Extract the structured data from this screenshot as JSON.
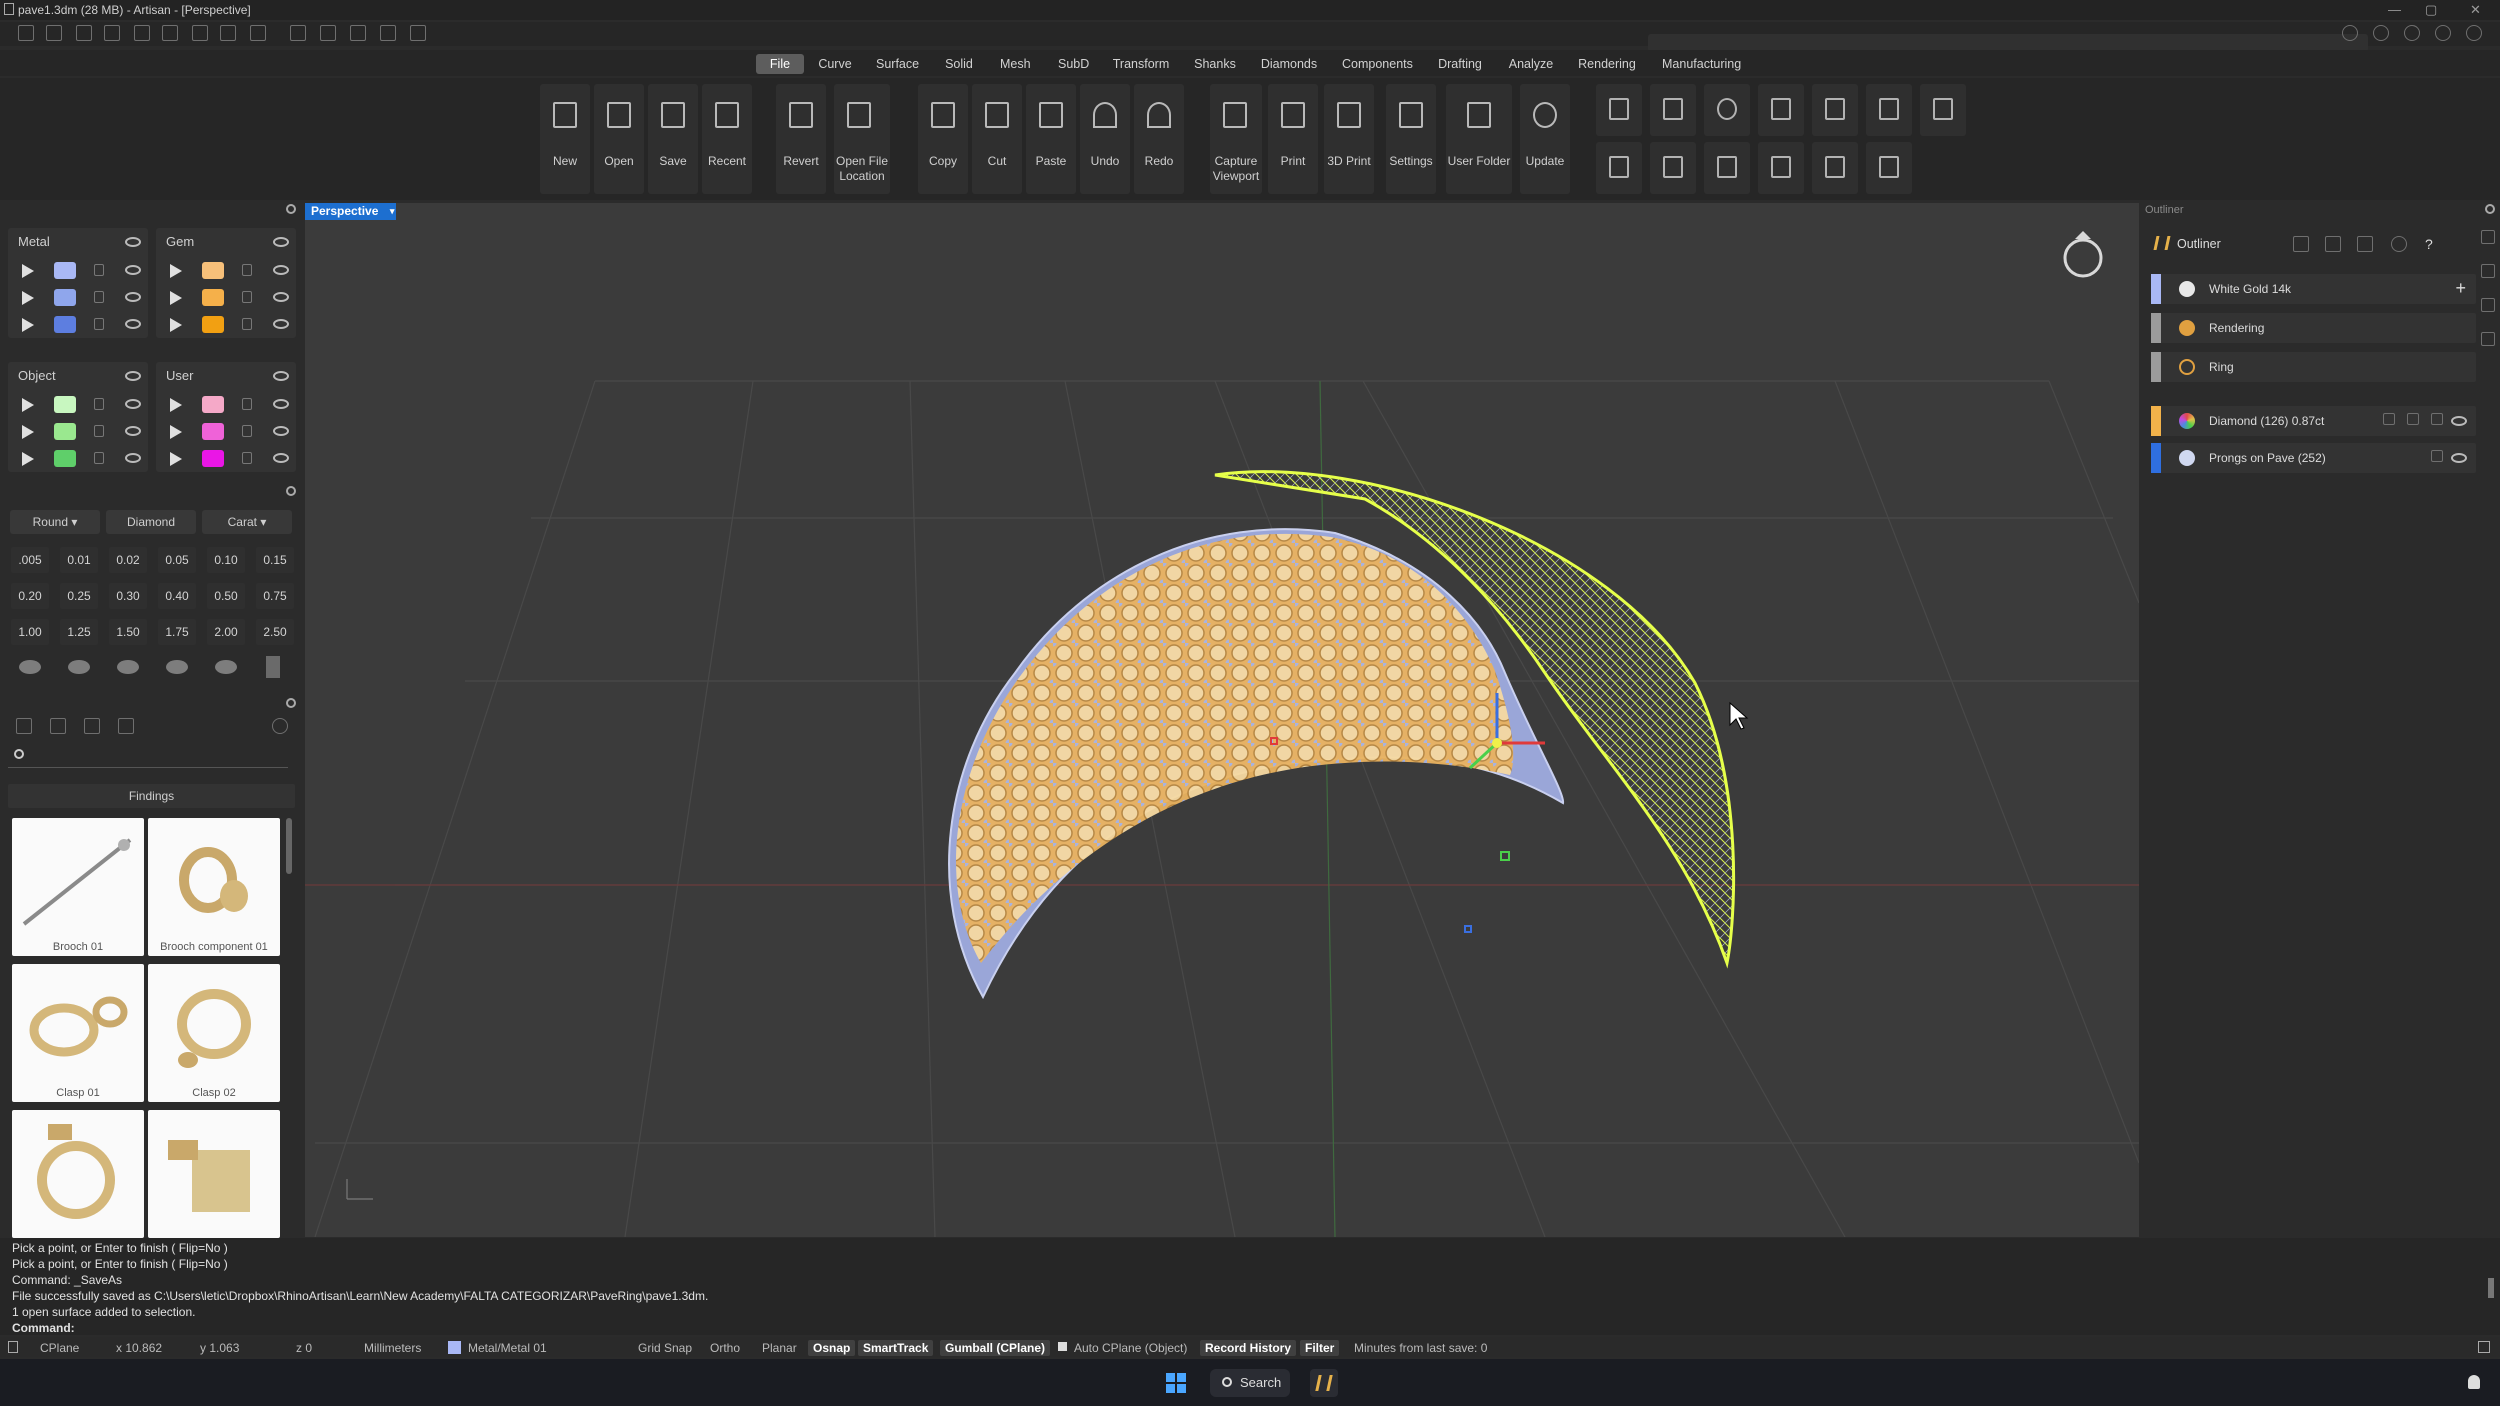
{
  "window": {
    "title": "pave1.3dm (28 MB) - Artisan - [Perspective]"
  },
  "menu": {
    "items": [
      "File",
      "Curve",
      "Surface",
      "Solid",
      "Mesh",
      "SubD",
      "Transform",
      "Shanks",
      "Diamonds",
      "Components",
      "Drafting",
      "Analyze",
      "Rendering",
      "Manufacturing"
    ],
    "active": "File"
  },
  "ribbon": {
    "buttons": [
      {
        "label": "New",
        "icon": "new-file-icon"
      },
      {
        "label": "Open",
        "icon": "folder-open-icon"
      },
      {
        "label": "Save",
        "icon": "save-icon"
      },
      {
        "label": "Recent",
        "icon": "recent-file-icon"
      },
      {
        "label": "Revert",
        "icon": "revert-icon"
      },
      {
        "label": "Open File Location",
        "icon": "folder-location-icon"
      },
      {
        "label": "Copy",
        "icon": "copy-icon"
      },
      {
        "label": "Cut",
        "icon": "scissors-icon"
      },
      {
        "label": "Paste",
        "icon": "paste-icon"
      },
      {
        "label": "Undo",
        "icon": "undo-icon"
      },
      {
        "label": "Redo",
        "icon": "redo-icon"
      },
      {
        "label": "Capture Viewport",
        "icon": "capture-icon"
      },
      {
        "label": "Print",
        "icon": "print-icon"
      },
      {
        "label": "3D Print",
        "icon": "3d-print-icon"
      },
      {
        "label": "Settings",
        "icon": "settings-icon"
      },
      {
        "label": "User Folder",
        "icon": "user-folder-icon"
      },
      {
        "label": "Update",
        "icon": "refresh-icon"
      }
    ]
  },
  "layers": {
    "metal": {
      "title": "Metal",
      "colors": [
        "#a9b8f5",
        "#8fa6ec",
        "#5d7ee0"
      ]
    },
    "gem": {
      "title": "Gem",
      "colors": [
        "#f7c07a",
        "#f5b04a",
        "#f2a012"
      ]
    },
    "object": {
      "title": "Object",
      "colors": [
        "#c8f7c0",
        "#9ae88f",
        "#5fcf6a"
      ]
    },
    "user": {
      "title": "User",
      "colors": [
        "#f5a9c8",
        "#ef62d8",
        "#ea16e6"
      ]
    }
  },
  "gem_selector": {
    "cut": "Round",
    "type": "Diamond",
    "unit": "Carat",
    "sizes": [
      ".005",
      "0.01",
      "0.02",
      "0.05",
      "0.10",
      "0.15",
      "0.20",
      "0.25",
      "0.30",
      "0.40",
      "0.50",
      "0.75",
      "1.00",
      "1.25",
      "1.50",
      "1.75",
      "2.00",
      "2.50"
    ]
  },
  "library": {
    "search_placeholder": "",
    "category": "Findings",
    "items": [
      {
        "label": "Brooch 01"
      },
      {
        "label": "Brooch component 01"
      },
      {
        "label": "Clasp 01"
      },
      {
        "label": "Clasp 02"
      },
      {
        "label": ""
      },
      {
        "label": ""
      }
    ]
  },
  "viewport": {
    "name": "Perspective",
    "colors": {
      "metal": "#9aa6d8",
      "gems": "#f2c078",
      "wire": "#d8f04a"
    }
  },
  "outliner": {
    "title": "Outliner",
    "panel_label": "Outliner",
    "items": [
      {
        "label": "White Gold 14k",
        "color": "#a9b8f5"
      },
      {
        "label": "Rendering",
        "color": "#9b9b9b"
      },
      {
        "label": "Ring",
        "color": "#9b9b9b"
      },
      {
        "label": "Diamond (126) 0.87ct",
        "color": "#f2b24a"
      },
      {
        "label": "Prongs on Pave (252)",
        "color": "#2f6fe0"
      }
    ]
  },
  "command": {
    "history": [
      "Pick a point, or Enter to finish ( Flip=No )",
      "Pick a point, or Enter to finish ( Flip=No )",
      "Command: _SaveAs",
      "File successfully saved as C:\\Users\\letic\\Dropbox\\RhinoArtisan\\Learn\\New Academy\\FALTA CATEGORIZAR\\PaveRing\\pave1.3dm.",
      "1 open surface added to selection."
    ],
    "prompt": "Command:"
  },
  "status": {
    "cplane": "CPlane",
    "x": "x 10.862",
    "y": "y 1.063",
    "z": "z 0",
    "units": "Millimeters",
    "layer": "Metal/Metal 01",
    "toggles": [
      {
        "label": "Grid Snap",
        "on": false
      },
      {
        "label": "Ortho",
        "on": false
      },
      {
        "label": "Planar",
        "on": false
      },
      {
        "label": "Osnap",
        "on": true
      },
      {
        "label": "SmartTrack",
        "on": true
      },
      {
        "label": "Gumball (CPlane)",
        "on": true
      },
      {
        "label": "Auto CPlane (Object)",
        "on": false
      },
      {
        "label": "Record History",
        "on": true
      },
      {
        "label": "Filter",
        "on": true
      }
    ],
    "save_info": "Minutes from last save: 0"
  },
  "taskbar": {
    "search": "Search"
  }
}
